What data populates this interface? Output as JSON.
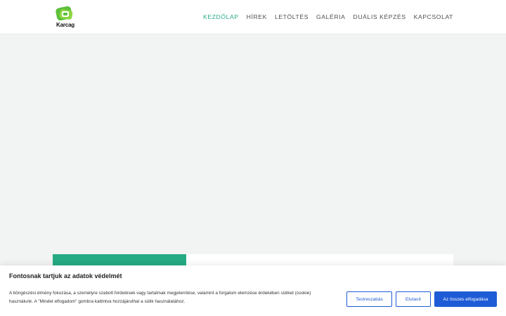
{
  "header": {
    "logo_text": "Karcag",
    "nav": [
      {
        "label": "KEZDŐLAP",
        "active": true
      },
      {
        "label": "HÍREK"
      },
      {
        "label": "LETÖLTÉS"
      },
      {
        "label": "GALÉRIA"
      },
      {
        "label": "DUÁLIS KÉPZÉS"
      },
      {
        "label": "KAPCSOLAT"
      }
    ]
  },
  "colors": {
    "accent_green": "#2aaa8a",
    "card_green": "#24ab84",
    "button_blue": "#1e5bd6",
    "hero_bg": "#f2f3f3"
  },
  "cookie": {
    "title": "Fontosnak tartjuk az adatok védelmét",
    "text": "A böngészési élmény fokozása, a személyre szabott hirdetések vagy tartalmak megjelenítése, valamint a forgalom elemzése érdekében sütiket (cookie) használunk. A \"Mindet elfogadom\" gombra kattintva hozzájárulhat a sütik használatához.",
    "buttons": {
      "customize": "Testreszabás",
      "reject": "Elutasít",
      "accept": "Az összes elfogadása"
    }
  }
}
